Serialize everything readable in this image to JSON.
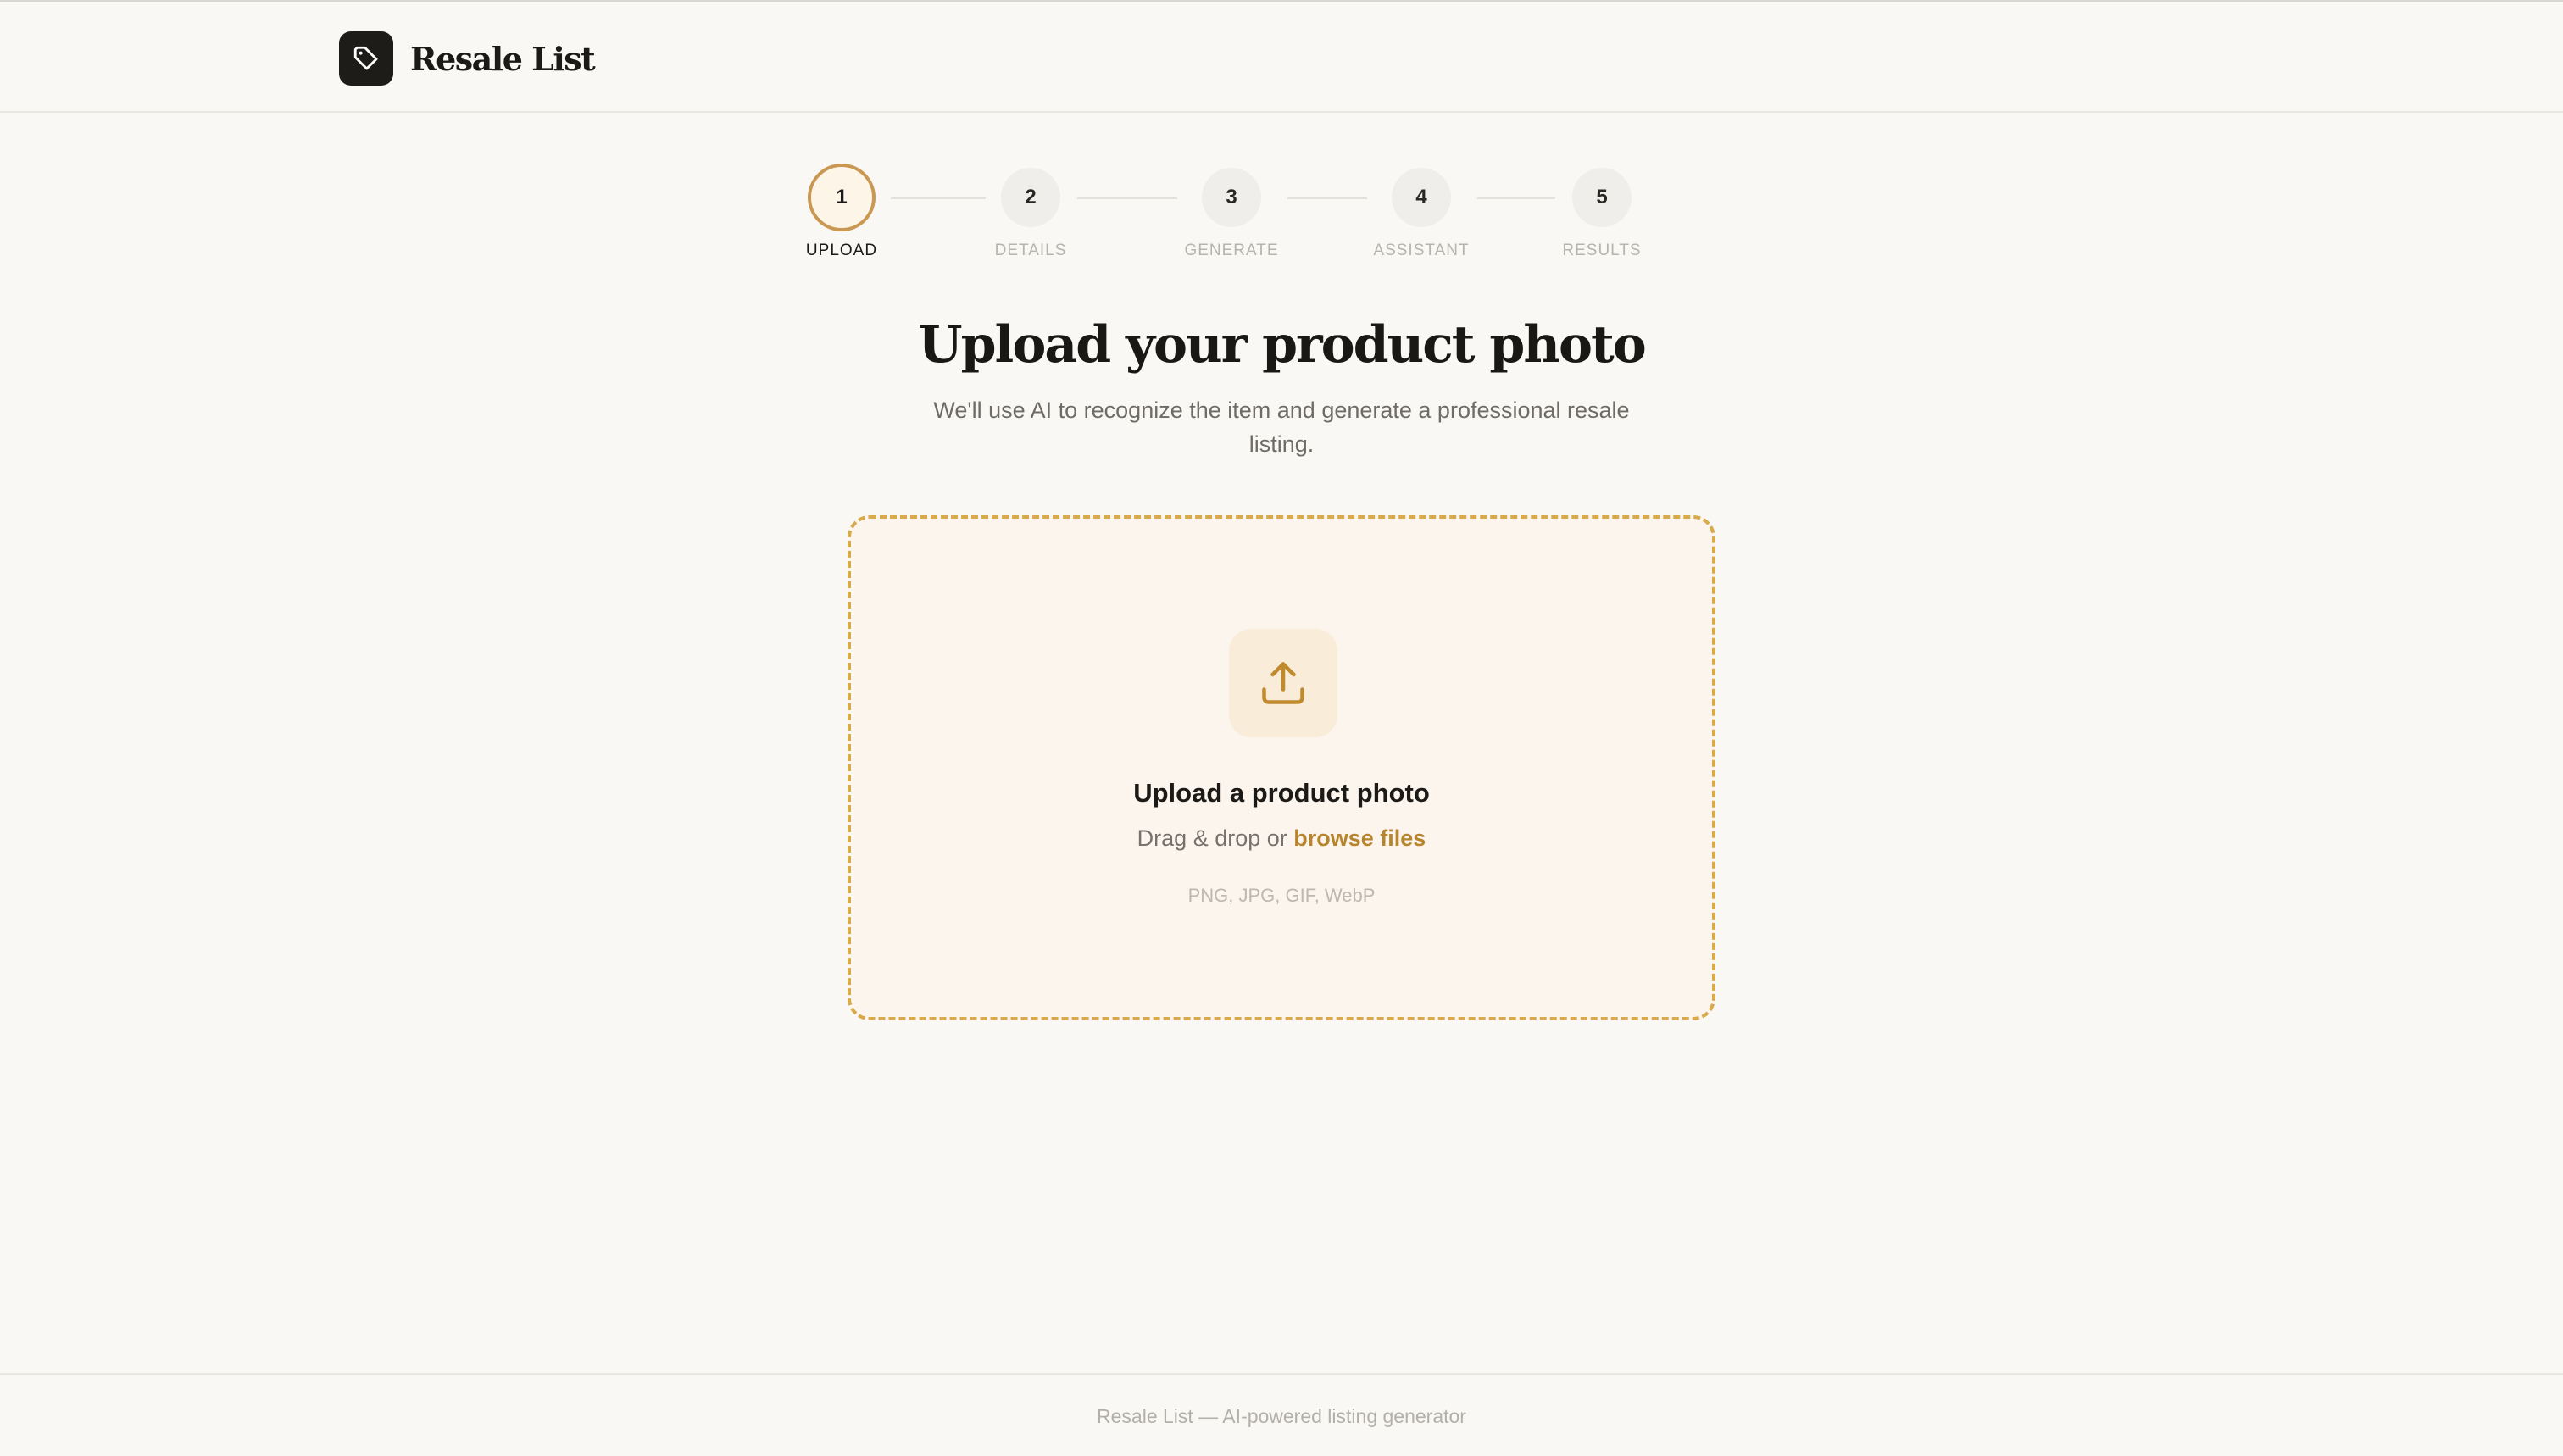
{
  "brand": {
    "name": "Resale List",
    "icon": "tag-icon"
  },
  "stepper": {
    "active_index": 0,
    "steps": [
      {
        "number": "1",
        "label": "UPLOAD"
      },
      {
        "number": "2",
        "label": "DETAILS"
      },
      {
        "number": "3",
        "label": "GENERATE"
      },
      {
        "number": "4",
        "label": "ASSISTANT"
      },
      {
        "number": "5",
        "label": "RESULTS"
      }
    ]
  },
  "main": {
    "title": "Upload your product photo",
    "subtitle": "We'll use AI to recognize the item and generate a professional resale listing."
  },
  "dropzone": {
    "icon": "upload-icon",
    "title": "Upload a product photo",
    "hint_prefix": "Drag & drop or ",
    "browse_label": "browse files",
    "formats": "PNG, JPG, GIF, WebP"
  },
  "footer": {
    "text": "Resale List — AI-powered listing generator"
  },
  "colors": {
    "accent": "#c99852",
    "link": "#b7852e",
    "dashed_border": "#d7aa4c",
    "background": "#f9f8f5",
    "brand_dark": "#1e1c19"
  }
}
